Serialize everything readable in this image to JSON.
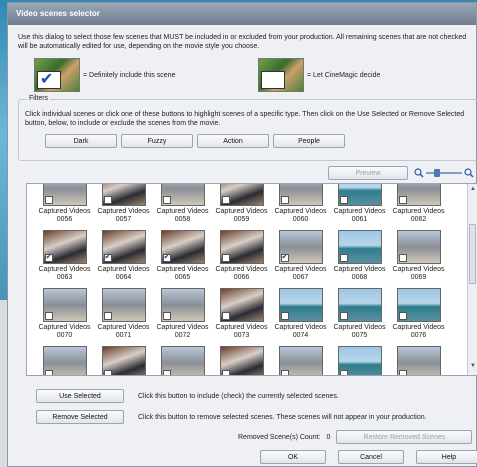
{
  "dialog": {
    "title": "Video scenes selector",
    "intro": "Use this dialog to select those few scenes that MUST be included in or excluded from your production. All remaining scenes that are not checked will be automatically edited for use, depending on the movie style you choose.",
    "legend_include": "= Definitely include this scene",
    "legend_decide": "= Let CineMagic decide"
  },
  "filters": {
    "group_label": "Filters",
    "description": "Click individual scenes or click one of these buttons to highlight scenes of a specific type. Then click on the Use Selected or Remove Selected button, below, to include or exclude the scenes from the movie.",
    "buttons": [
      "Dark",
      "Fuzzy",
      "Action",
      "People"
    ]
  },
  "preview_label": "Preview",
  "scenes": [
    {
      "label": "Captured Videos",
      "num": "0056",
      "checked": false,
      "style": "street"
    },
    {
      "label": "Captured Videos",
      "num": "0057",
      "checked": false,
      "style": "room"
    },
    {
      "label": "Captured Videos",
      "num": "0058",
      "checked": false,
      "style": "street"
    },
    {
      "label": "Captured Videos",
      "num": "0059",
      "checked": false,
      "style": "room"
    },
    {
      "label": "Captured Videos",
      "num": "0060",
      "checked": false,
      "style": "street"
    },
    {
      "label": "Captured Videos",
      "num": "0061",
      "checked": false,
      "style": "sea"
    },
    {
      "label": "Captured Videos",
      "num": "0062",
      "checked": false,
      "style": "street"
    },
    {
      "label": "Captured Videos",
      "num": "0063",
      "checked": true,
      "style": "room"
    },
    {
      "label": "Captured Videos",
      "num": "0064",
      "checked": true,
      "style": "room"
    },
    {
      "label": "Captured Videos",
      "num": "0065",
      "checked": true,
      "style": "room"
    },
    {
      "label": "Captured Videos",
      "num": "0066",
      "checked": false,
      "style": "room"
    },
    {
      "label": "Captured Videos",
      "num": "0067",
      "checked": true,
      "style": "street"
    },
    {
      "label": "Captured Videos",
      "num": "0068",
      "checked": false,
      "style": "sea"
    },
    {
      "label": "Captured Videos",
      "num": "0069",
      "checked": false,
      "style": "street"
    },
    {
      "label": "Captured Videos",
      "num": "0070",
      "checked": false,
      "style": "street"
    },
    {
      "label": "Captured Videos",
      "num": "0071",
      "checked": false,
      "style": "street"
    },
    {
      "label": "Captured Videos",
      "num": "0072",
      "checked": false,
      "style": "street"
    },
    {
      "label": "Captured Videos",
      "num": "0073",
      "checked": false,
      "style": "room"
    },
    {
      "label": "Captured Videos",
      "num": "0074",
      "checked": false,
      "style": "sea"
    },
    {
      "label": "Captured Videos",
      "num": "0075",
      "checked": false,
      "style": "sea"
    },
    {
      "label": "Captured Videos",
      "num": "0076",
      "checked": false,
      "style": "sea"
    },
    {
      "label": "",
      "num": "",
      "checked": false,
      "style": "street"
    },
    {
      "label": "",
      "num": "",
      "checked": false,
      "style": "room"
    },
    {
      "label": "",
      "num": "",
      "checked": false,
      "style": "street"
    },
    {
      "label": "",
      "num": "",
      "checked": false,
      "style": "room"
    },
    {
      "label": "",
      "num": "",
      "checked": false,
      "style": "street"
    },
    {
      "label": "",
      "num": "",
      "checked": false,
      "style": "sea"
    },
    {
      "label": "",
      "num": "",
      "checked": false,
      "style": "street"
    }
  ],
  "actions": {
    "use_selected": "Use Selected",
    "use_selected_desc": "Click this button to include (check) the currently selected scenes.",
    "remove_selected": "Remove Selected",
    "remove_selected_desc": "Click this button to remove selected scenes. These scenes will not appear in your production."
  },
  "removed": {
    "count_label": "Removed Scene(s) Count:",
    "count": "0",
    "restore_label": "Restore Removed Scenes"
  },
  "footer": {
    "ok": "OK",
    "cancel": "Cancel",
    "help": "Help"
  }
}
